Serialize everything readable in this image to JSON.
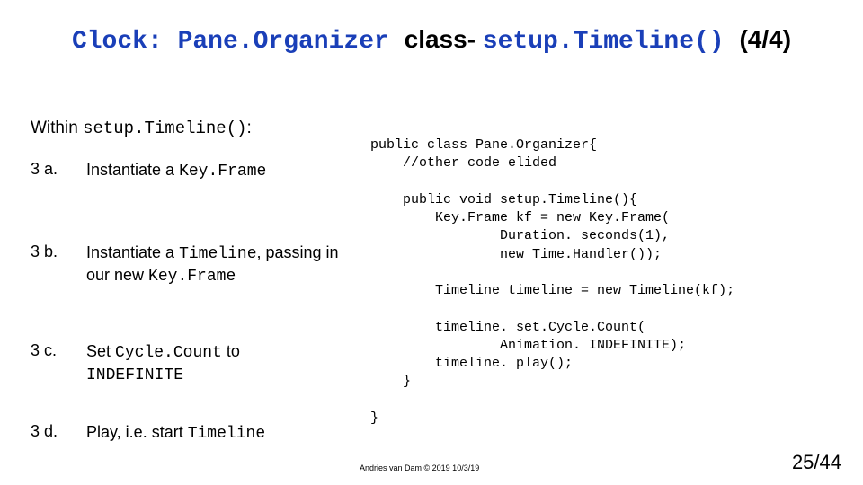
{
  "title": {
    "part1": "Clock: Pane.Organizer ",
    "part2": "class- ",
    "part3": "setup.Timeline() ",
    "part4": "(4/4)"
  },
  "subhead": {
    "prefix": "Within ",
    "code": "setup.Timeline()",
    "suffix": ":"
  },
  "steps": {
    "a": {
      "num": "3 a.",
      "pre": "Instantiate a ",
      "mono": "Key.Frame"
    },
    "b": {
      "num": "3 b.",
      "pre": "Instantiate a ",
      "mono1": "Timeline",
      "mid": ", passing in our new ",
      "mono2": "Key.Frame"
    },
    "c": {
      "num": "3 c.",
      "pre": "Set ",
      "mono1": "Cycle.Count",
      "mid": " to",
      "mono2": "INDEFINITE"
    },
    "d": {
      "num": "3 d.",
      "pre": "Play, i.e. start ",
      "mono": "Timeline"
    }
  },
  "code": "public class Pane.Organizer{\n    //other code elided\n\n    public void setup.Timeline(){\n        Key.Frame kf = new Key.Frame(\n                Duration. seconds(1),\n                new Time.Handler());\n\n        Timeline timeline = new Timeline(kf);\n\n        timeline. set.Cycle.Count(\n                Animation. INDEFINITE);\n        timeline. play();\n    }\n\n}",
  "footer": {
    "credit": "Andries van Dam © 2019 10/3/19",
    "page": "25/44"
  }
}
